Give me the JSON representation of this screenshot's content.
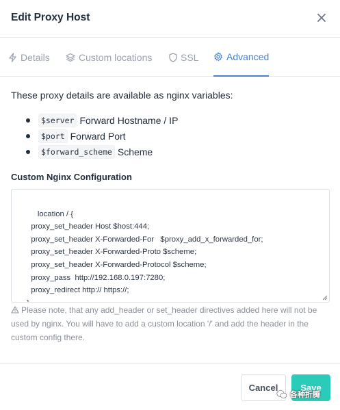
{
  "dialog": {
    "title": "Edit Proxy Host"
  },
  "tabs": [
    {
      "label": "Details",
      "icon": "zap-icon",
      "active": false
    },
    {
      "label": "Custom locations",
      "icon": "layers-icon",
      "active": false
    },
    {
      "label": "SSL",
      "icon": "shield-icon",
      "active": false
    },
    {
      "label": "Advanced",
      "icon": "gear-icon",
      "active": true
    }
  ],
  "advanced": {
    "intro": "These proxy details are available as nginx variables:",
    "variables": [
      {
        "code": "$server",
        "desc": "Forward Hostname / IP"
      },
      {
        "code": "$port",
        "desc": "Forward Port"
      },
      {
        "code": "$forward_scheme",
        "desc": "Scheme"
      }
    ],
    "config_label": "Custom Nginx Configuration",
    "config_value": "location / {\n   proxy_set_header Host $host:444;\n   proxy_set_header X-Forwarded-For   $proxy_add_x_forwarded_for;\n   proxy_set_header X-Forwarded-Proto $scheme;\n   proxy_set_header X-Forwarded-Protocol $scheme;\n   proxy_pass  http://192.168.0.197:7280;\n   proxy_redirect http:// https://;\n }",
    "note": "Please note, that any add_header or set_header directives added here will not be used by nginx. You will have to add a custom location '/' and add the header in the custom config there."
  },
  "footer": {
    "cancel_label": "Cancel",
    "save_label": "Save"
  },
  "watermark": "各种折腾",
  "colors": {
    "accent": "#467fcf",
    "save": "#2bcbba",
    "muted": "#9aa0ac"
  }
}
